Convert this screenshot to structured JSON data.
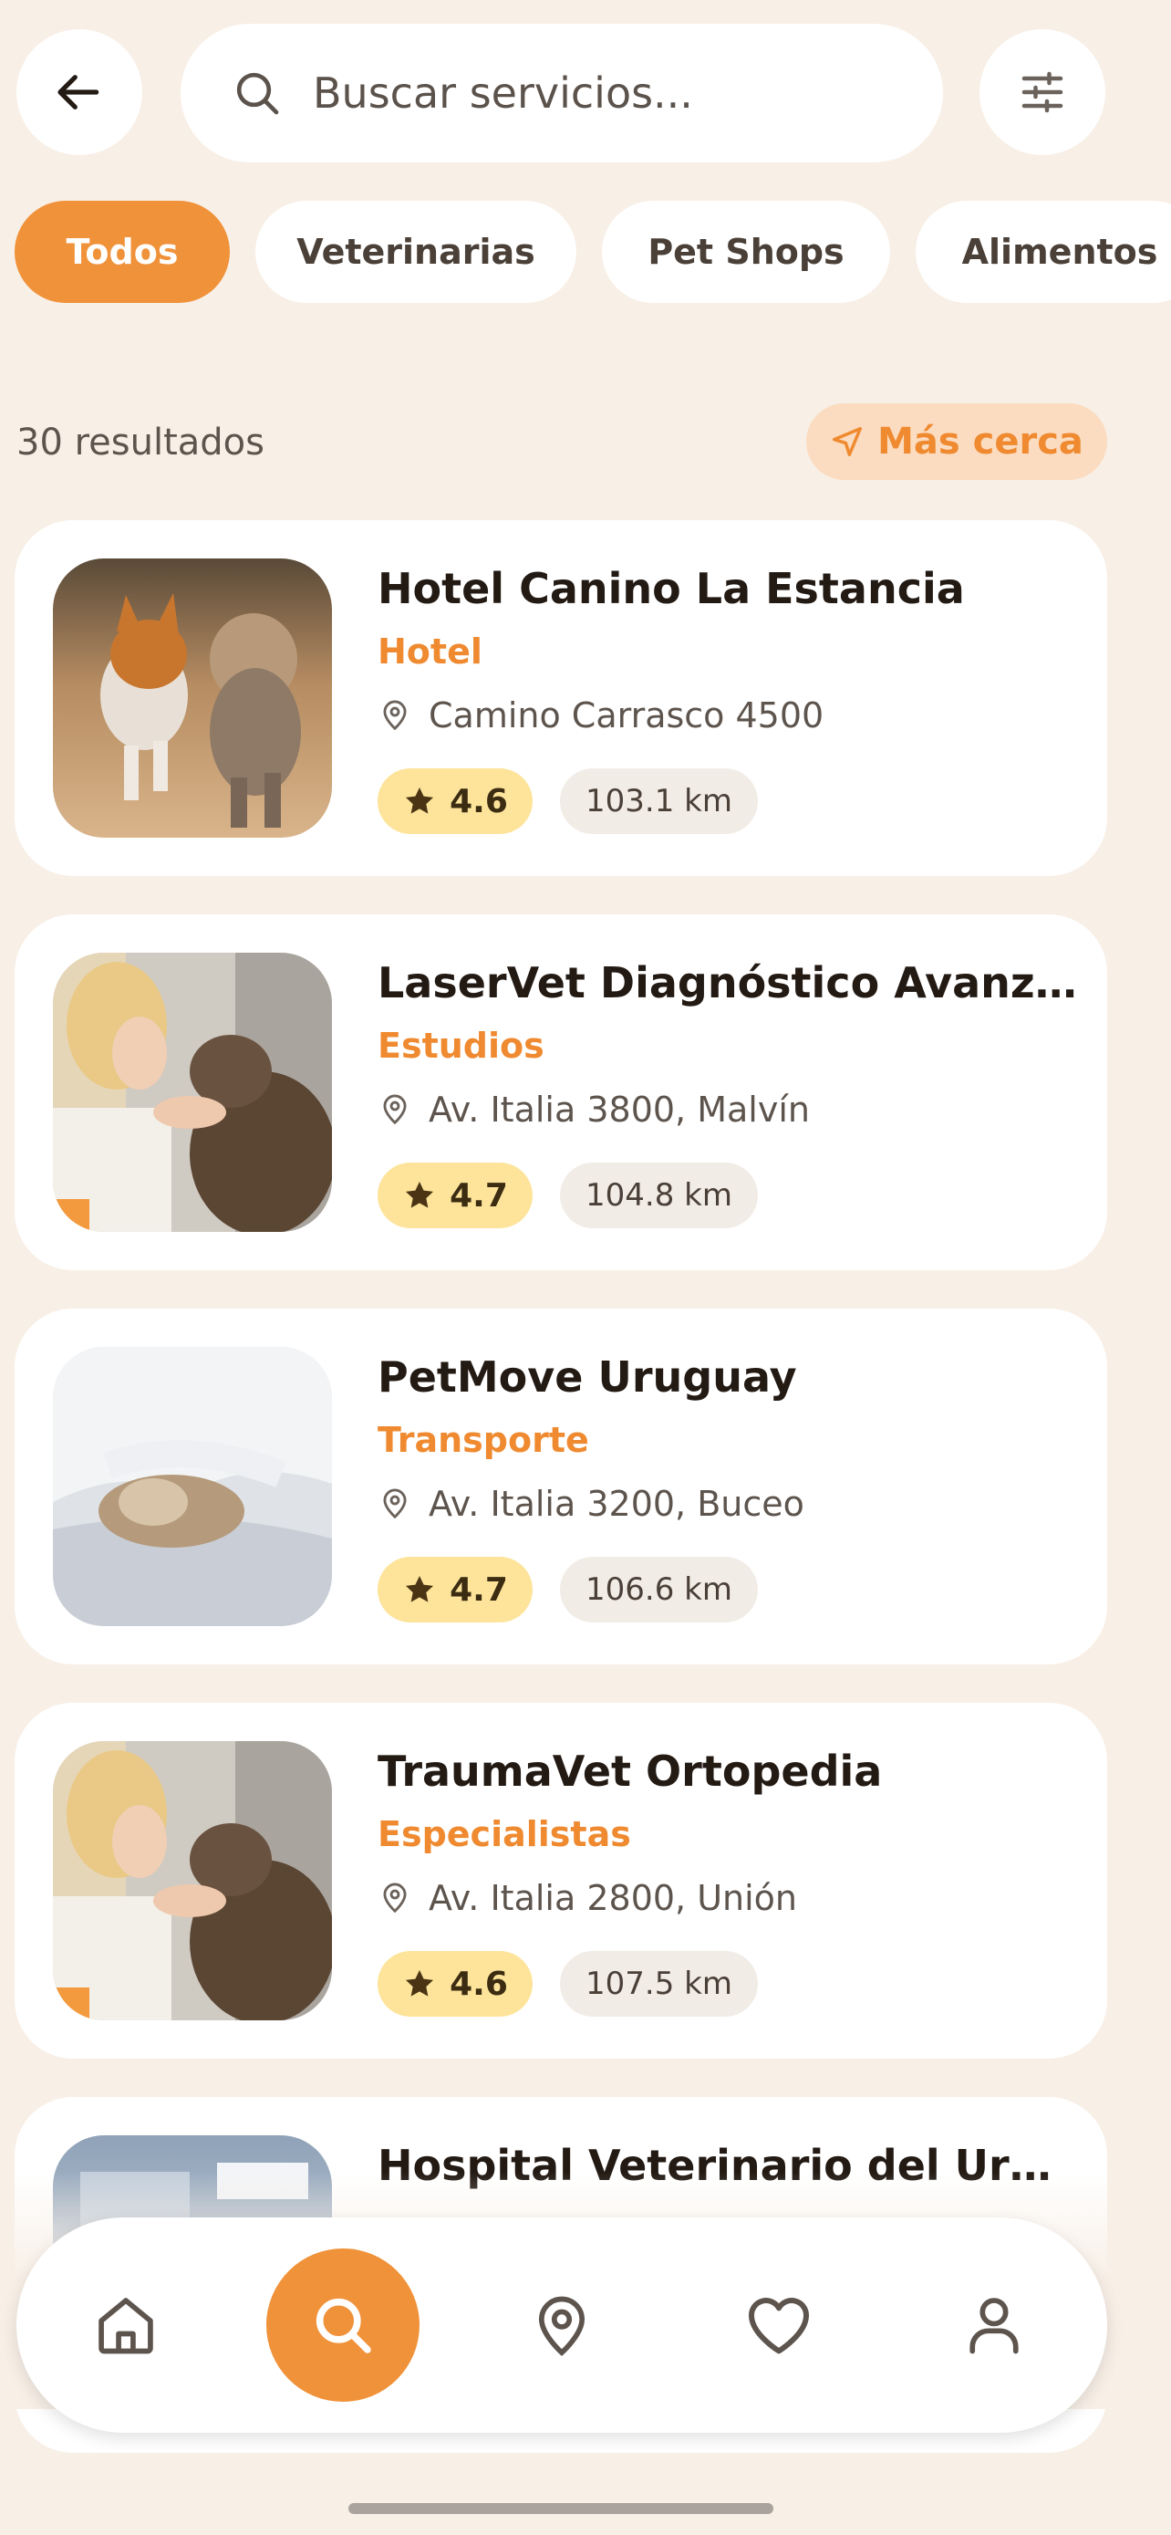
{
  "search": {
    "placeholder": "Buscar servicios..."
  },
  "header_icons": {
    "back": "arrow-left-icon",
    "filter": "sliders-icon",
    "search": "search-icon"
  },
  "chips": [
    {
      "label": "Todos",
      "active": true
    },
    {
      "label": "Veterinarias",
      "active": false
    },
    {
      "label": "Pet Shops",
      "active": false
    },
    {
      "label": "Alimentos",
      "active": false
    }
  ],
  "results": {
    "count_label": "30 resultados",
    "nearby_label": "Más cerca"
  },
  "cards": [
    {
      "title": "Hotel Canino La Estancia",
      "category": "Hotel",
      "address": "Camino Carrasco 4500",
      "rating": "4.6",
      "distance": "103.1 km"
    },
    {
      "title": "LaserVet Diagnóstico Avanza...",
      "category": "Estudios",
      "address": "Av. Italia 3800, Malvín",
      "rating": "4.7",
      "distance": "104.8 km"
    },
    {
      "title": "PetMove Uruguay",
      "category": "Transporte",
      "address": "Av. Italia 3200, Buceo",
      "rating": "4.7",
      "distance": "106.6 km"
    },
    {
      "title": "TraumaVet Ortopedia",
      "category": "Especialistas",
      "address": "Av. Italia 2800, Unión",
      "rating": "4.6",
      "distance": "107.5 km"
    },
    {
      "title": "Hospital Veterinario del Urug...",
      "category": "",
      "address": "",
      "rating": "",
      "distance": ""
    }
  ],
  "bottom_nav": [
    {
      "icon": "home-icon",
      "active": false
    },
    {
      "icon": "search-icon",
      "active": true
    },
    {
      "icon": "map-pin-icon",
      "active": false
    },
    {
      "icon": "heart-icon",
      "active": false
    },
    {
      "icon": "user-icon",
      "active": false
    }
  ],
  "colors": {
    "accent": "#f0923a",
    "background": "#f8efe6",
    "rating_bg": "#fde49a",
    "nearby_bg": "#fbdcc0"
  }
}
